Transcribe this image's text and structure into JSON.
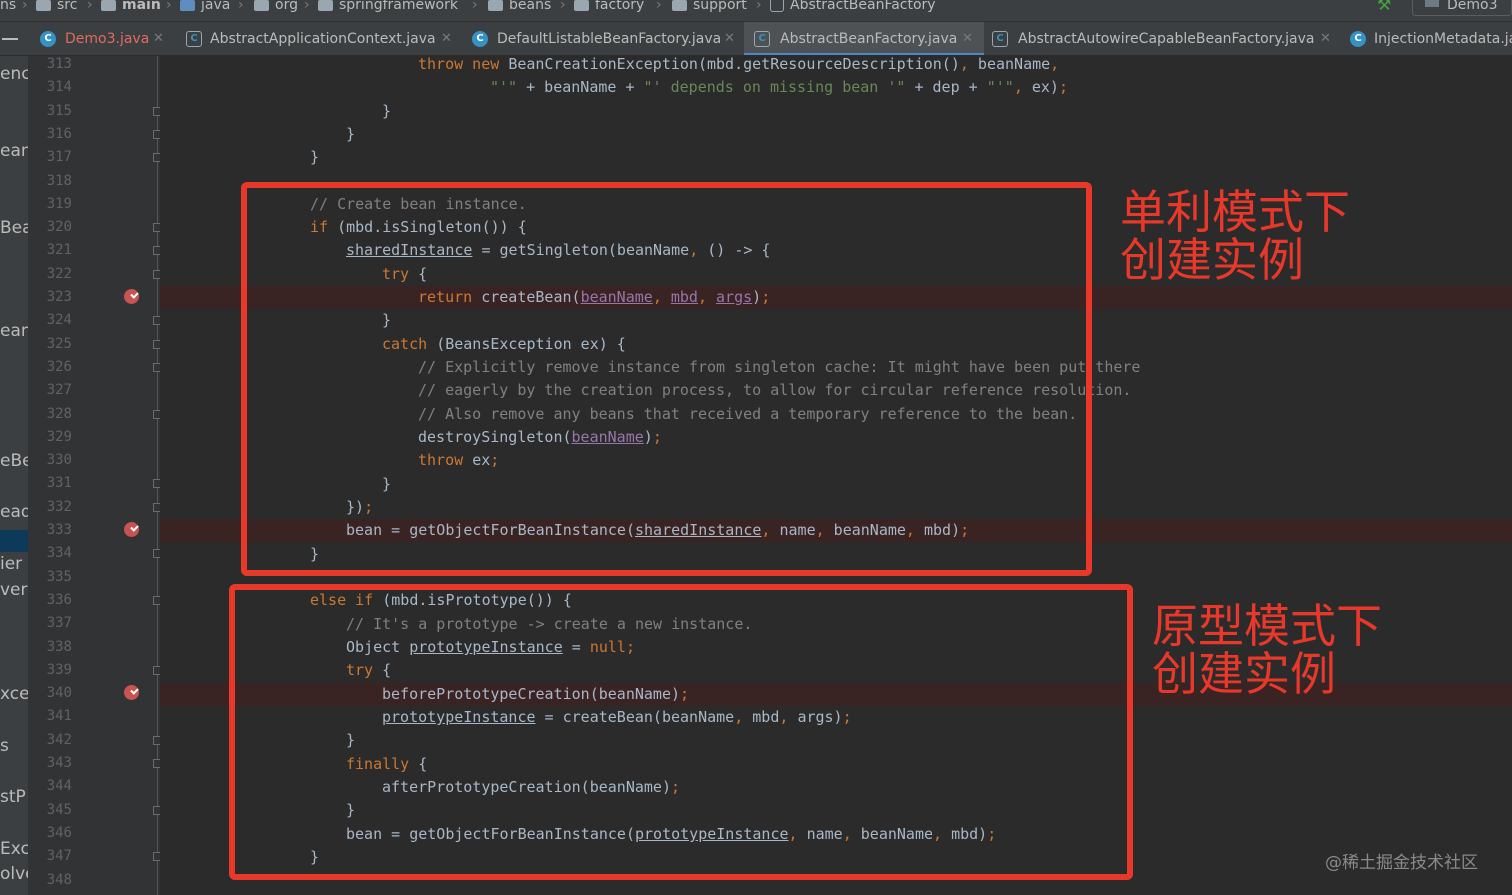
{
  "breadcrumb": [
    {
      "label": "ns",
      "icon": "none"
    },
    {
      "label": "src",
      "icon": "folder-icon"
    },
    {
      "label": "main",
      "icon": "folder-icon"
    },
    {
      "label": "java",
      "icon": "source-folder-icon"
    },
    {
      "label": "org",
      "icon": "package-icon"
    },
    {
      "label": "springframework",
      "icon": "package-icon"
    },
    {
      "label": "beans",
      "icon": "package-icon"
    },
    {
      "label": "factory",
      "icon": "package-icon"
    },
    {
      "label": "support",
      "icon": "package-icon"
    },
    {
      "label": "AbstractBeanFactory",
      "icon": "abstract-class-icon"
    }
  ],
  "run_config": "Demo3",
  "tabs": [
    {
      "label": "Demo3.java",
      "icon": "class-icon",
      "modified": true,
      "active": false
    },
    {
      "label": "AbstractApplicationContext.java",
      "icon": "abstract-class-icon",
      "active": false
    },
    {
      "label": "DefaultListableBeanFactory.java",
      "icon": "class-icon",
      "active": false
    },
    {
      "label": "AbstractBeanFactory.java",
      "icon": "abstract-class-icon",
      "active": true
    },
    {
      "label": "AbstractAutowireCapableBeanFactory.java",
      "icon": "abstract-class-icon",
      "active": false
    },
    {
      "label": "InjectionMetadata.ja",
      "icon": "class-icon",
      "active": false
    }
  ],
  "left_stripe": [
    "enc",
    "ean",
    "Bea",
    "ean",
    "eBe",
    "ead",
    "ier",
    "ver",
    "xce",
    "s",
    "stP",
    "Exc",
    "olve"
  ],
  "line_numbers": [
    "313",
    "314",
    "315",
    "316",
    "317",
    "318",
    "319",
    "320",
    "321",
    "322",
    "323",
    "324",
    "325",
    "326",
    "327",
    "328",
    "329",
    "330",
    "331",
    "332",
    "333",
    "334",
    "335",
    "336",
    "337",
    "338",
    "339",
    "340",
    "341",
    "342",
    "343",
    "344",
    "345",
    "346",
    "347",
    "348"
  ],
  "breakpoint_lines": [
    "323",
    "333",
    "340"
  ],
  "annotations": {
    "singleton": "单利模式下\n创建实例",
    "prototype": "原型模式下\n创建实例"
  },
  "watermark": "@稀土掘金技术社区",
  "colors": {
    "annotation": "#e8382a",
    "keyword": "#cc7832",
    "comment": "#808080",
    "string": "#6a8759",
    "field": "#9876aa",
    "text": "#a9b7c6",
    "background": "#2b2b2b"
  }
}
